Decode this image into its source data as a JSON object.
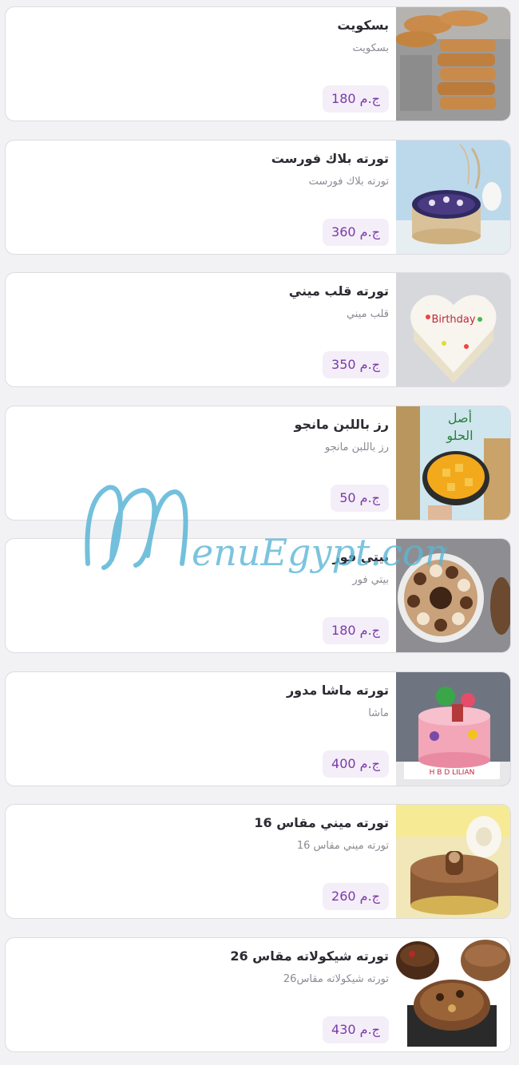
{
  "menu": {
    "items": [
      {
        "title": "بسكويت",
        "description": "بسكويت",
        "price": "180 ج.م",
        "image_icon": "biscuits-image-icon"
      },
      {
        "title": "تورته بلاك فورست",
        "description": "تورته بلاك فورست",
        "price": "360 ج.م",
        "image_icon": "black-forest-cake-image-icon"
      },
      {
        "title": "تورته قلب ميني",
        "description": "قلب ميني",
        "price": "350 ج.م",
        "image_icon": "heart-cake-image-icon"
      },
      {
        "title": "رز باللبن مانجو",
        "description": "رز باللبن مانجو",
        "price": "50 ج.م",
        "image_icon": "rice-pudding-mango-image-icon"
      },
      {
        "title": "بيتي فور",
        "description": "بيتي فور",
        "price": "180 ج.م",
        "image_icon": "petit-four-image-icon"
      },
      {
        "title": "تورته ماشا مدور",
        "description": "ماشا",
        "price": "400 ج.م",
        "image_icon": "masha-cake-image-icon"
      },
      {
        "title": "تورته ميني مقاس 16",
        "description": "تورته ميني مقاس 16",
        "price": "260 ج.م",
        "image_icon": "mini-cake-image-icon"
      },
      {
        "title": "تورته شيكولاته مقاس 26",
        "description": "تورته شيكولاته مقاس26",
        "price": "430 ج.م",
        "image_icon": "chocolate-cake-image-icon"
      }
    ]
  },
  "watermark": {
    "text": "MenuEgypt.com",
    "color": "#5bb6d6"
  },
  "colors": {
    "price_text": "#7a3aa8",
    "price_bg": "#f4eef8",
    "title": "#2b2b33",
    "description": "#8a8a94"
  }
}
